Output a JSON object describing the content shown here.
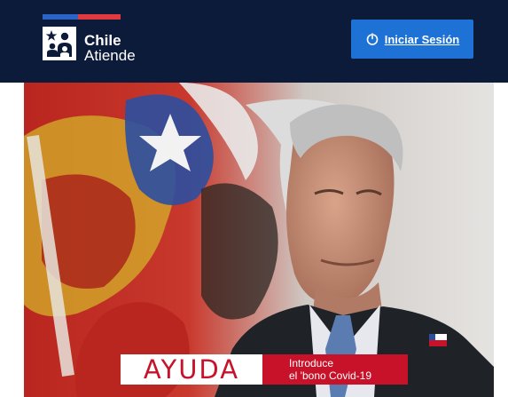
{
  "header": {
    "logo": {
      "line1": "Chile",
      "line2": "Atiende"
    },
    "login_button": {
      "label": "Iniciar Sesión",
      "icon": "power-icon"
    }
  },
  "hero": {
    "alt": "",
    "banner": {
      "title": "AYUDA",
      "subtitle_line1": "Introduce",
      "subtitle_line2": "el 'bono Covid-19"
    }
  },
  "colors": {
    "header_bg": "#0d1b3a",
    "button_bg": "#1e72d6",
    "flag_blue": "#2a64c7",
    "flag_red": "#e03a3e",
    "banner_red": "#c7122a"
  }
}
